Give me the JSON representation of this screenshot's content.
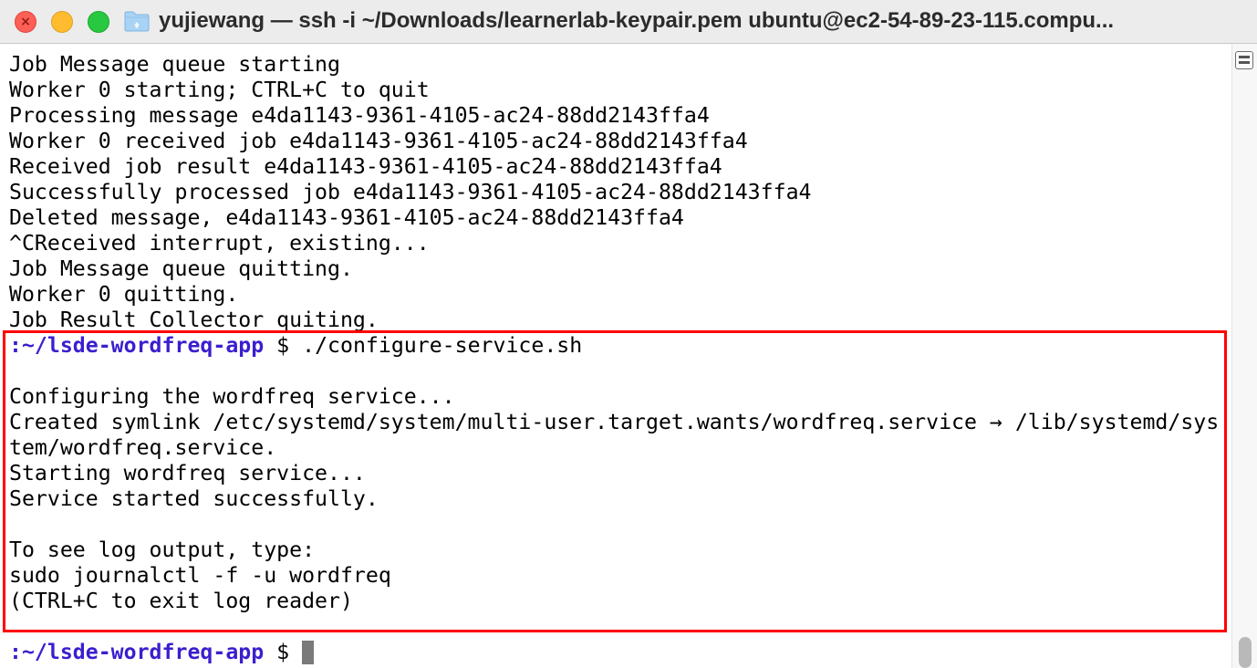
{
  "window": {
    "title": "yujiewang — ssh -i ~/Downloads/learnerlab-keypair.pem ubuntu@ec2-54-89-23-115.compu...",
    "title_icon": "folder-icon",
    "close_glyph": "×"
  },
  "terminal": {
    "lines": [
      "Job Message queue starting",
      "Worker 0 starting; CTRL+C to quit",
      "Processing message e4da1143-9361-4105-ac24-88dd2143ffa4",
      "Worker 0 received job e4da1143-9361-4105-ac24-88dd2143ffa4",
      "Received job result e4da1143-9361-4105-ac24-88dd2143ffa4",
      "Successfully processed job e4da1143-9361-4105-ac24-88dd2143ffa4",
      "Deleted message, e4da1143-9361-4105-ac24-88dd2143ffa4",
      "^CReceived interrupt, existing...",
      "Job Message queue quitting.",
      "Worker 0 quitting.",
      "Job Result Collector quiting."
    ],
    "prompt_path": ":~/lsde-wordfreq-app",
    "prompt_symbol": "$",
    "command": "./configure-service.sh",
    "output": [
      "",
      "Configuring the wordfreq service...",
      "Created symlink /etc/systemd/system/multi-user.target.wants/wordfreq.service → /lib/systemd/sys",
      "tem/wordfreq.service.",
      "Starting wordfreq service...",
      "Service started successfully.",
      "",
      "To see log output, type:",
      "sudo journalctl -f -u wordfreq",
      "(CTRL+C to exit log reader)"
    ],
    "final_prompt_path": ":~/lsde-wordfreq-app",
    "final_prompt_symbol": "$"
  },
  "colors": {
    "prompt_path": "#3a1fcf",
    "highlight_border": "#ff0000",
    "text": "#000000",
    "background": "#ffffff"
  }
}
